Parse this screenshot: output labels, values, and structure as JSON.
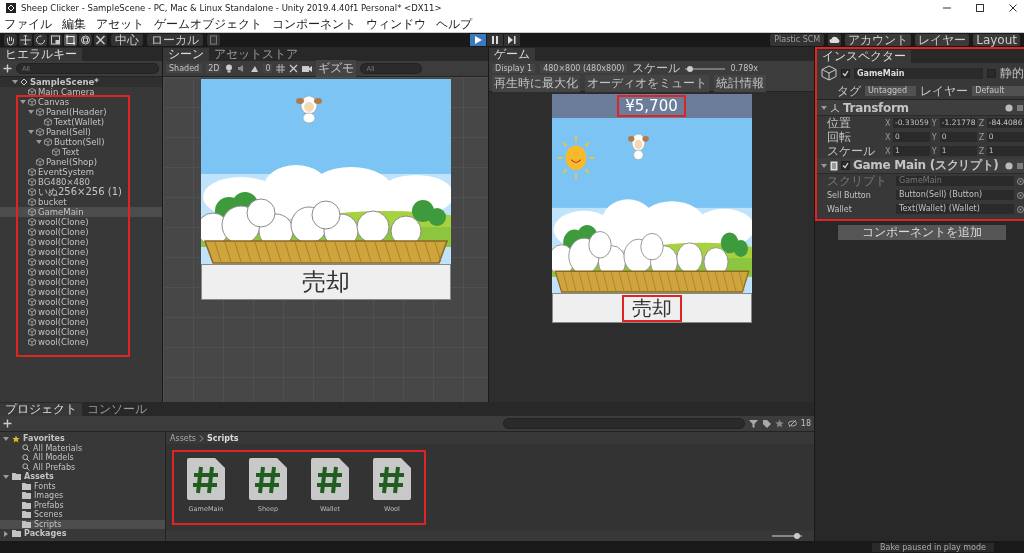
{
  "window": {
    "title": "Sheep Clicker - SampleScene - PC, Mac & Linux Standalone - Unity 2019.4.40f1 Personal* <DX11>"
  },
  "menu": [
    "ファイル",
    "編集",
    "アセット",
    "ゲームオブジェクト",
    "コンポーネント",
    "ウィンドウ",
    "ヘルプ"
  ],
  "toolbar": {
    "pivot": "中心",
    "space": "ローカル",
    "playing": true,
    "plastic": "Plastic SCM",
    "account": "アカウント",
    "layers": "レイヤー",
    "layout": "Layout"
  },
  "hierarchy": {
    "title": "ヒエラルキー",
    "search_placeholder": "All",
    "items": [
      {
        "kind": "scene",
        "label": "SampleScene*",
        "selected": false,
        "expanded": true,
        "children": [
          {
            "kind": "object",
            "label": "Main Camera",
            "selected": false
          },
          {
            "kind": "object",
            "label": "Canvas",
            "selected": false,
            "expanded": true,
            "children": [
              {
                "kind": "object",
                "label": "Panel(Header)",
                "selected": false,
                "expanded": true,
                "children": [
                  {
                    "kind": "object",
                    "label": "Text(Wallet)",
                    "selected": false
                  }
                ]
              },
              {
                "kind": "object",
                "label": "Panel(Sell)",
                "selected": false,
                "expanded": true,
                "children": [
                  {
                    "kind": "object",
                    "label": "Button(Sell)",
                    "selected": false,
                    "expanded": true,
                    "children": [
                      {
                        "kind": "object",
                        "label": "Text",
                        "selected": false
                      }
                    ]
                  }
                ]
              },
              {
                "kind": "object",
                "label": "Panel(Shop)",
                "selected": false
              }
            ]
          },
          {
            "kind": "object",
            "label": "EventSystem",
            "selected": false
          },
          {
            "kind": "object",
            "label": "BG480×480",
            "selected": false
          },
          {
            "kind": "object",
            "label": "いぬ256×256 (1)",
            "selected": false
          },
          {
            "kind": "object",
            "label": "bucket",
            "selected": false
          },
          {
            "kind": "object",
            "label": "GameMain",
            "selected": true
          },
          {
            "kind": "object",
            "label": "wool(Clone)",
            "selected": false
          },
          {
            "kind": "object",
            "label": "wool(Clone)",
            "selected": false
          },
          {
            "kind": "object",
            "label": "wool(Clone)",
            "selected": false
          },
          {
            "kind": "object",
            "label": "wool(Clone)",
            "selected": false
          },
          {
            "kind": "object",
            "label": "wool(Clone)",
            "selected": false
          },
          {
            "kind": "object",
            "label": "wool(Clone)",
            "selected": false
          },
          {
            "kind": "object",
            "label": "wool(Clone)",
            "selected": false
          },
          {
            "kind": "object",
            "label": "wool(Clone)",
            "selected": false
          },
          {
            "kind": "object",
            "label": "wool(Clone)",
            "selected": false
          },
          {
            "kind": "object",
            "label": "wool(Clone)",
            "selected": false
          },
          {
            "kind": "object",
            "label": "wool(Clone)",
            "selected": false
          },
          {
            "kind": "object",
            "label": "wool(Clone)",
            "selected": false
          },
          {
            "kind": "object",
            "label": "wool(Clone)",
            "selected": false
          }
        ]
      }
    ]
  },
  "scene": {
    "tabs": [
      {
        "label": "シーン",
        "selected": true
      },
      {
        "label": "アセットストア",
        "selected": false
      }
    ],
    "shading": "Shaded",
    "mode_2d": "2D",
    "fx_count": "0",
    "gizmos": "ギズモ",
    "search_placeholder": "All",
    "sell_label": "売却"
  },
  "game": {
    "tab": "ゲーム",
    "display": "Display 1",
    "resolution": "480×800 (480x800)",
    "scale_label": "スケール",
    "scale_value": "0.789x",
    "scale_slider": {
      "level": 0.05
    },
    "toggles": [
      "再生時に最大化",
      "オーディオをミュート",
      "統計情報"
    ],
    "wallet": "¥5,700",
    "sell_label": "売却"
  },
  "inspector": {
    "title": "インスペクター",
    "object": {
      "active": true,
      "name": "GameMain",
      "static": false,
      "static_label": "静的",
      "tag_label": "タグ",
      "tag": "Untagged",
      "layer_label": "レイヤー",
      "layer": "Default"
    },
    "components": [
      {
        "kind": "transform",
        "title": "Transform",
        "expanded": true,
        "rows": [
          {
            "label": "位置",
            "values": [
              {
                "axis": "X",
                "value": "-0.33059"
              },
              {
                "axis": "Y",
                "value": "-1.21778"
              },
              {
                "axis": "Z",
                "value": "-84.4086"
              }
            ]
          },
          {
            "label": "回転",
            "values": [
              {
                "axis": "X",
                "value": "0"
              },
              {
                "axis": "Y",
                "value": "0"
              },
              {
                "axis": "Z",
                "value": "0"
              }
            ]
          },
          {
            "label": "スケール",
            "values": [
              {
                "axis": "X",
                "value": "1"
              },
              {
                "axis": "Y",
                "value": "1"
              },
              {
                "axis": "Z",
                "value": "1"
              }
            ]
          }
        ]
      },
      {
        "kind": "script",
        "title": "Game Main (スクリプト)",
        "expanded": true,
        "enabled": true,
        "fields": [
          {
            "label": "スクリプト",
            "value": "GameMain",
            "disabled": true
          },
          {
            "label": "Sell Button",
            "value": "Button(Sell) (Button)",
            "disabled": false
          },
          {
            "label": "Wallet",
            "value": "Text(Wallet) (Wallet)",
            "disabled": false
          }
        ]
      }
    ],
    "add_button": "コンポーネントを追加"
  },
  "project": {
    "tabs": [
      {
        "label": "プロジェクト",
        "selected": true
      },
      {
        "label": "コンソール",
        "selected": false
      }
    ],
    "count": "18",
    "tree": [
      {
        "kind": "favorites",
        "label": "Favorites",
        "expanded": true,
        "children": [
          {
            "kind": "search",
            "label": "All Materials",
            "selected": false
          },
          {
            "kind": "search",
            "label": "All Models",
            "selected": false
          },
          {
            "kind": "search",
            "label": "All Prefabs",
            "selected": false
          }
        ]
      },
      {
        "kind": "folder",
        "label": "Assets",
        "expanded": true,
        "children": [
          {
            "kind": "folder",
            "label": "Fonts",
            "selected": false
          },
          {
            "kind": "folder",
            "label": "Images",
            "selected": false
          },
          {
            "kind": "folder",
            "label": "Prefabs",
            "selected": false
          },
          {
            "kind": "folder",
            "label": "Scenes",
            "selected": false
          },
          {
            "kind": "folder",
            "label": "Scripts",
            "selected": true
          }
        ]
      },
      {
        "kind": "folder",
        "label": "Packages",
        "expanded": false
      }
    ],
    "breadcrumb": [
      "Assets",
      "Scripts"
    ],
    "files": [
      "GameMain",
      "Sheep",
      "Wallet",
      "Wool"
    ],
    "icon_size_slider": {
      "level": 0.9
    }
  },
  "status": "Bake paused in play mode"
}
